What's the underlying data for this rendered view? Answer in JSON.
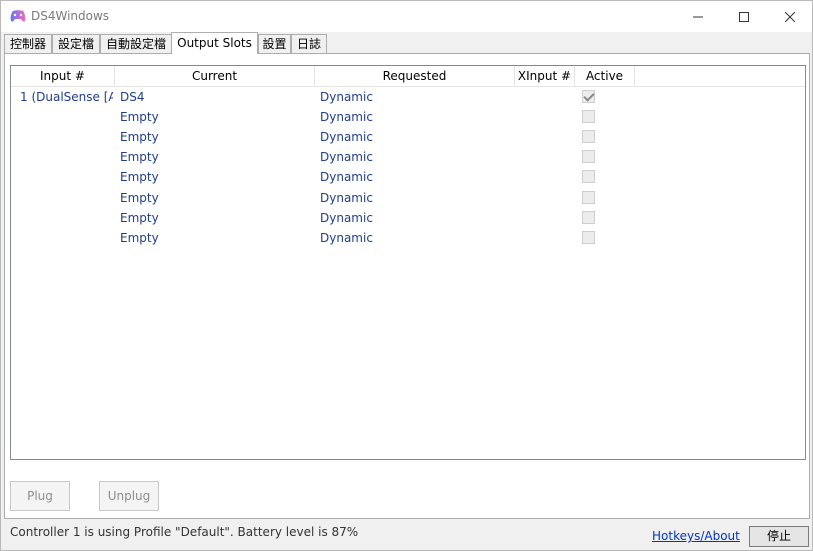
{
  "window": {
    "title": "DS4Windows",
    "icon": "gamepad-icon",
    "controls": {
      "minimize": "minimize-icon",
      "maximize": "maximize-icon",
      "close": "close-icon"
    }
  },
  "tabs": [
    {
      "label": "控制器"
    },
    {
      "label": "設定檔"
    },
    {
      "label": "自動設定檔"
    },
    {
      "label": "Output Slots",
      "active": true
    },
    {
      "label": "設置"
    },
    {
      "label": "日誌"
    }
  ],
  "list": {
    "columns": [
      "Input #",
      "Current",
      "Requested",
      "XInput #",
      "Active"
    ],
    "rows": [
      {
        "input": "1 (DualSense [A",
        "current": "DS4",
        "requested": "Dynamic",
        "xinput": "",
        "active": true
      },
      {
        "input": "",
        "current": "Empty",
        "requested": "Dynamic",
        "xinput": "",
        "active": false
      },
      {
        "input": "",
        "current": "Empty",
        "requested": "Dynamic",
        "xinput": "",
        "active": false
      },
      {
        "input": "",
        "current": "Empty",
        "requested": "Dynamic",
        "xinput": "",
        "active": false
      },
      {
        "input": "",
        "current": "Empty",
        "requested": "Dynamic",
        "xinput": "",
        "active": false
      },
      {
        "input": "",
        "current": "Empty",
        "requested": "Dynamic",
        "xinput": "",
        "active": false
      },
      {
        "input": "",
        "current": "Empty",
        "requested": "Dynamic",
        "xinput": "",
        "active": false
      },
      {
        "input": "",
        "current": "Empty",
        "requested": "Dynamic",
        "xinput": "",
        "active": false
      }
    ]
  },
  "buttons": {
    "plug": "Plug",
    "unplug": "Unplug"
  },
  "status": {
    "text": "Controller 1 is using Profile \"Default\". Battery level is 87%",
    "hotkeys_link": "Hotkeys/About",
    "stop_button": "停止"
  },
  "colors": {
    "row_text": "#1e3d8f",
    "link": "#0033cc"
  }
}
